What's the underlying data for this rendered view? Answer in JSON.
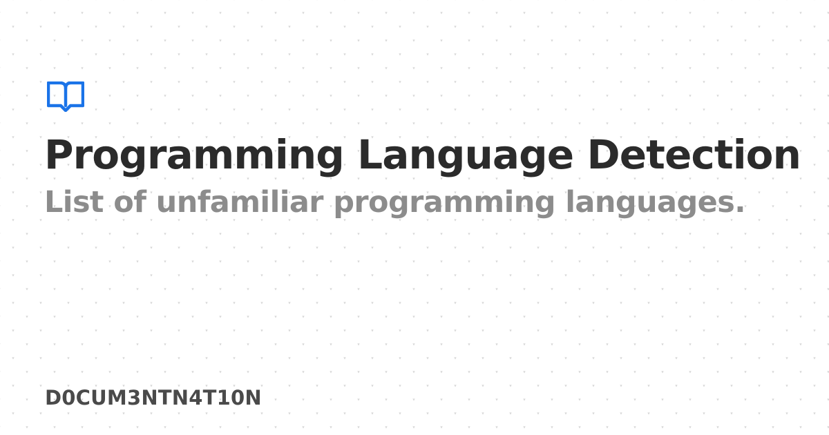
{
  "page": {
    "title": "Programming Language Detection",
    "subtitle": "List of unfamiliar programming languages.",
    "brand": "D0CUM3NTN4T10N"
  },
  "icons": {
    "logo": "book-icon",
    "background": "dot-pattern"
  },
  "colors": {
    "background": "#ffffff",
    "accent": "#1a73e8",
    "title": "#2b2b2b",
    "subtitle": "#8c8c8c",
    "brand": "#4a4a4a",
    "dots": "#d6d6d6"
  }
}
